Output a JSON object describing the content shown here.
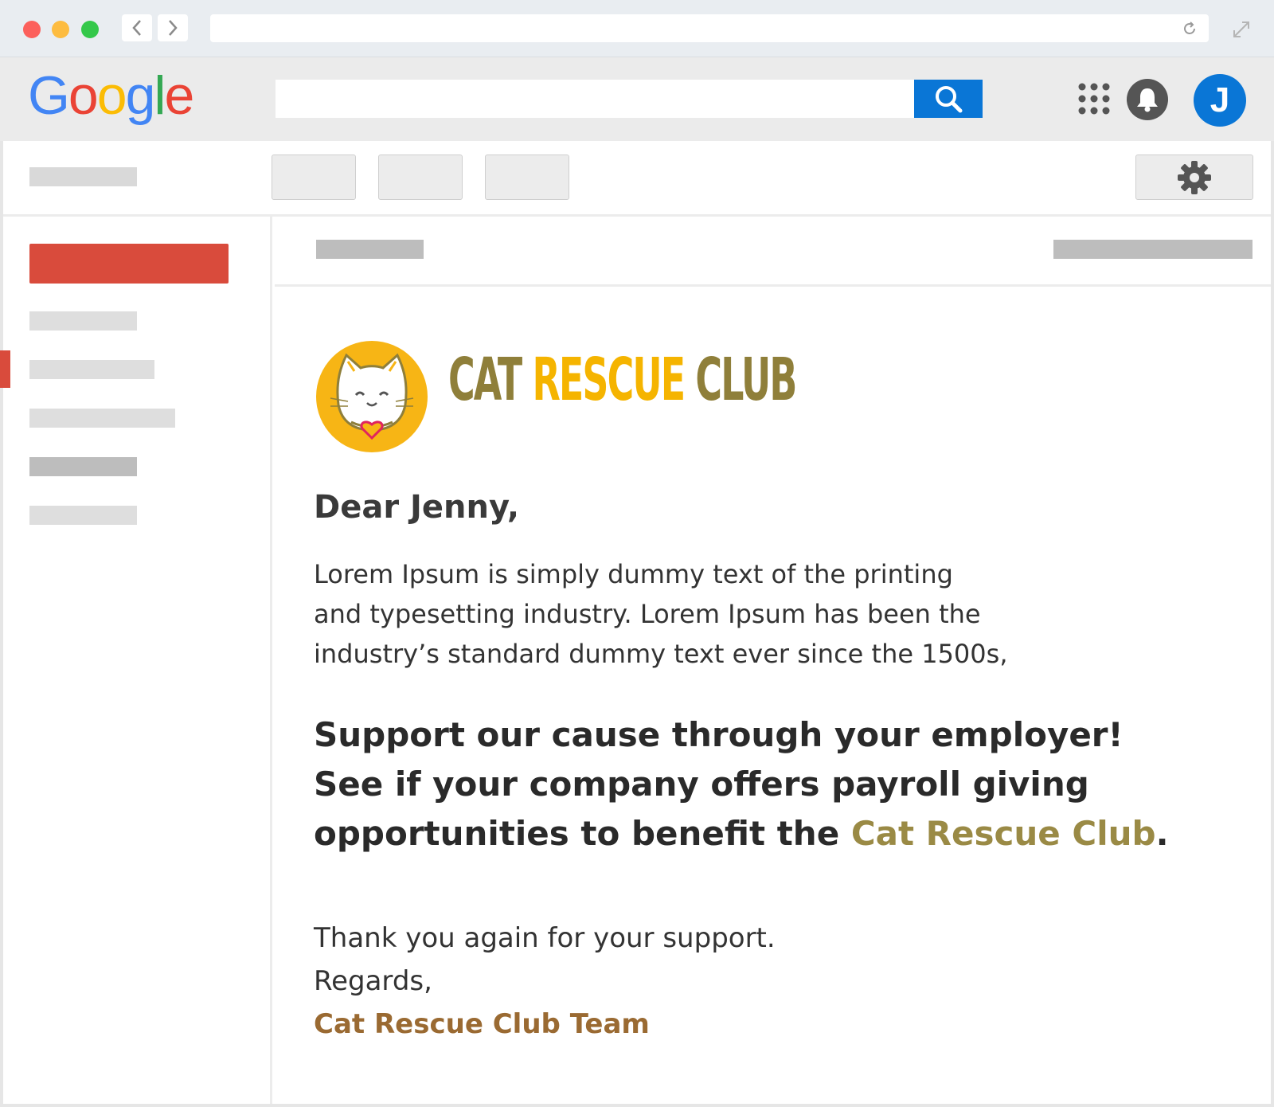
{
  "browser": {
    "icons": {
      "back": "chevron-left-icon",
      "forward": "chevron-right-icon",
      "reload": "reload-icon",
      "expand": "expand-icon"
    }
  },
  "header": {
    "logo_letters": [
      "G",
      "o",
      "o",
      "g",
      "l",
      "e"
    ],
    "logo_colors": [
      "#4285f4",
      "#ea4335",
      "#fbbc05",
      "#4285f4",
      "#34a853",
      "#ea4335"
    ],
    "search_placeholder": "",
    "avatar_initial": "J",
    "icons": {
      "search": "search-icon",
      "apps": "apps-grid-icon",
      "notifications": "bell-icon"
    },
    "colors": {
      "search_button": "#0a76d6",
      "avatar": "#0a76d6"
    }
  },
  "toolbar": {
    "settings_icon": "gear-icon"
  },
  "sidebar": {
    "compose_color": "#d94b3c"
  },
  "email": {
    "brand_word_1": "CAT",
    "brand_word_2": "RESCUE",
    "brand_word_3": "CLUB",
    "brand_colors": {
      "primary": "#8f7f3a",
      "accent": "#f5b400"
    },
    "greeting": "Dear Jenny,",
    "paragraph_line_1": "Lorem Ipsum is simply dummy text of the printing",
    "paragraph_line_2": "and typesetting industry. Lorem Ipsum has been the",
    "paragraph_line_3": "industry’s standard dummy text ever since the 1500s,",
    "cta_line_1": "Support our cause through your employer!",
    "cta_line_2": "See if your company offers payroll giving",
    "cta_line_3_prefix": "opportunities to benefit the ",
    "cta_line_3_link": "Cat Rescue Club",
    "cta_line_3_suffix": ".",
    "thanks": "Thank you again for your support.",
    "regards": "Regards,",
    "signature": "Cat Rescue Club Team"
  }
}
